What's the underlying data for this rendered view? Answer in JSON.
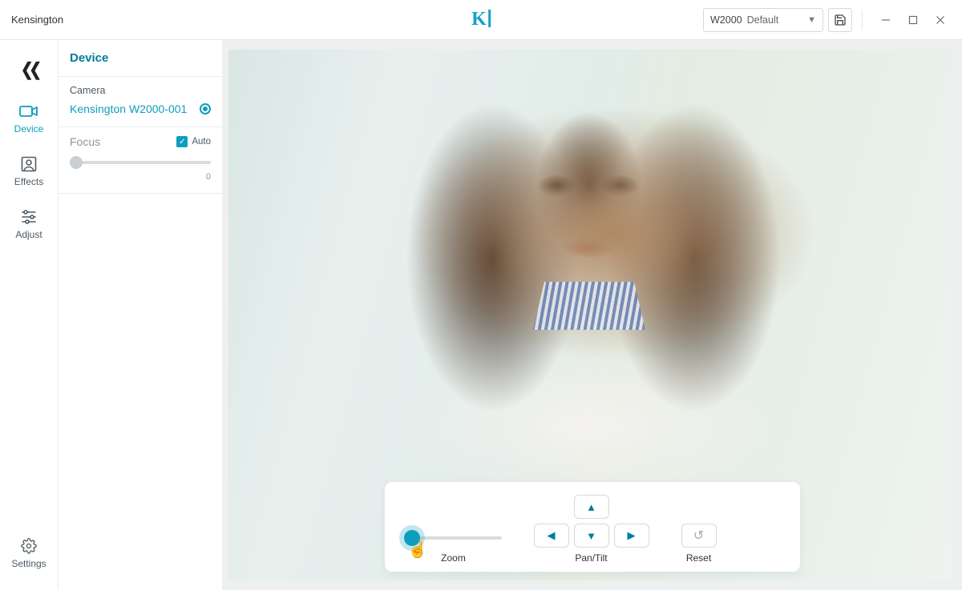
{
  "titlebar": {
    "app_title": "Kensington",
    "preset": {
      "name": "W2000",
      "value": "Default"
    }
  },
  "sidebar": {
    "items": [
      {
        "id": "device",
        "label": "Device"
      },
      {
        "id": "effects",
        "label": "Effects"
      },
      {
        "id": "adjust",
        "label": "Adjust"
      },
      {
        "id": "settings",
        "label": "Settings"
      }
    ]
  },
  "panel": {
    "title": "Device",
    "camera_section_label": "Camera",
    "camera_name": "Kensington W2000-001",
    "focus_label": "Focus",
    "auto_label": "Auto",
    "focus_value": "0"
  },
  "controls": {
    "zoom_label": "Zoom",
    "pantilt_label": "Pan/Tilt",
    "reset_label": "Reset"
  },
  "colors": {
    "brand": "#0d9dbf"
  }
}
